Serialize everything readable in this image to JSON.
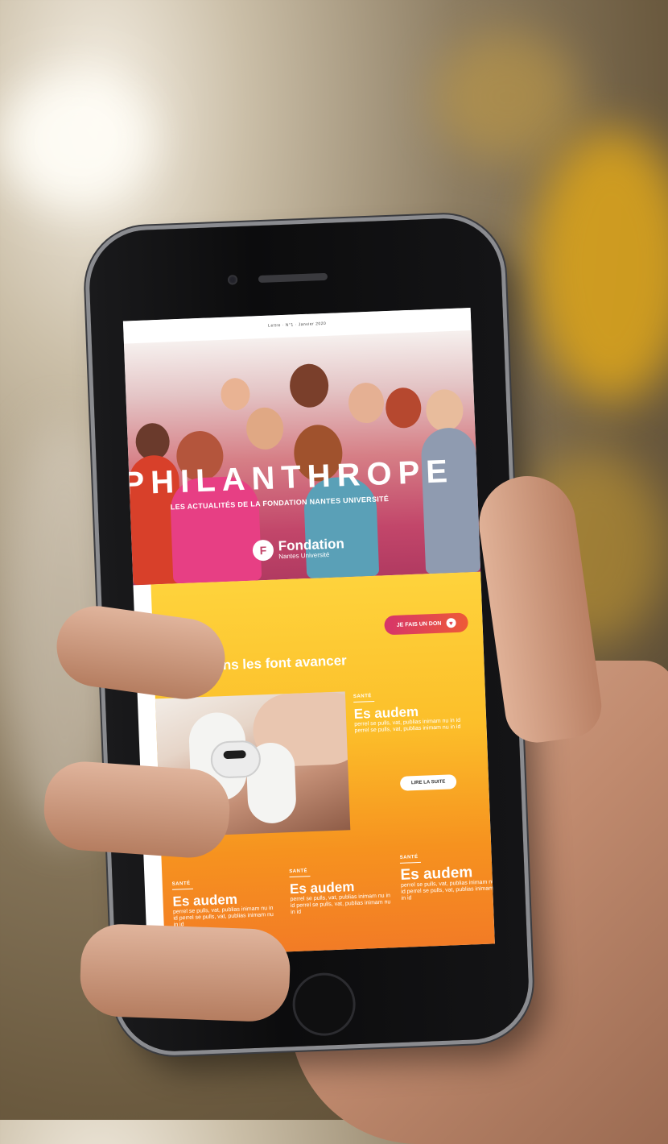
{
  "newsletter": {
    "top_line": "Lettre · N°1 · Janvier 2020",
    "hero_title": "PHILANTHROPE",
    "hero_subtitle": "LES ACTUALITÉS DE LA FONDATION NANTES UNIVERSITÉ",
    "logo": {
      "mark": "F",
      "name": "Fondation",
      "subname": "Nantes Université"
    },
    "donate_button": "JE FAIS UN DON",
    "headline": "Vos dons les font avancer",
    "featured": {
      "category": "SANTÉ",
      "title": "Es audem",
      "text": "perrel se pulls, vat, publias inimam nu in id perrel se pulls, vat, publias inimam nu in id",
      "button": "LIRE LA SUITE"
    },
    "articles": [
      {
        "category": "SANTÉ",
        "title": "Es audem",
        "text": "perrel se pulls, vat, publias inimam nu in id perrel se pulls, vat, publias inimam nu in id"
      },
      {
        "category": "SANTÉ",
        "title": "Es audem",
        "text": "perrel se pulls, vat, publias inimam nu in id perrel se pulls, vat, publias inimam nu in id"
      },
      {
        "category": "SANTÉ",
        "title": "Es audem",
        "text": "perrel se pulls, vat, publias inimam nu in id perrel se pulls, vat, publias inimam nu in id"
      }
    ]
  },
  "colors": {
    "gradient_top": "#fed33c",
    "gradient_bottom": "#f27a26",
    "hero_pink": "#c2466a",
    "button_pink": "#d6356a"
  }
}
